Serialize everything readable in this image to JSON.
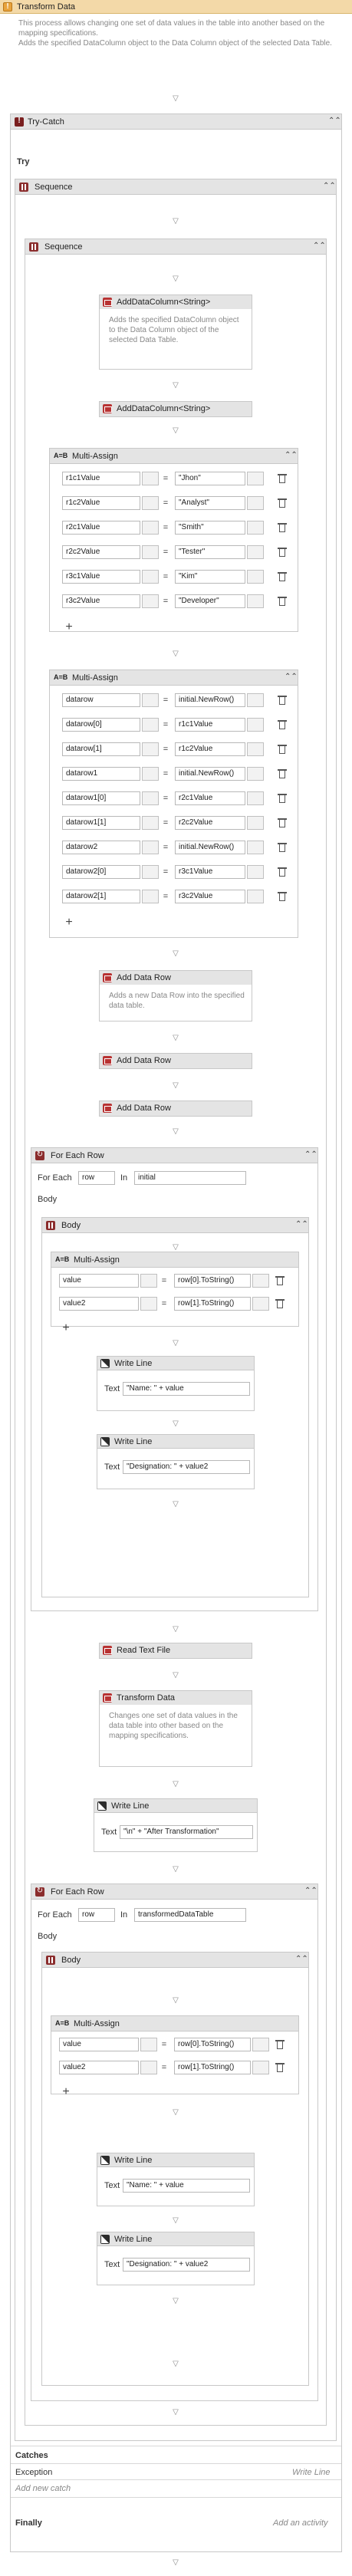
{
  "root": {
    "title": "Transform Data",
    "description": "This process allows changing one set of data values in the table into another based on the mapping specifications.\nAdds the specified DataColumn object to the Data Column object of the selected Data Table."
  },
  "try_catch": {
    "title": "Try-Catch",
    "try_label": "Try",
    "catches_label": "Catches",
    "exception_label": "Exception",
    "exception_action": "Write Line",
    "add_catch": "Add new catch",
    "finally_label": "Finally",
    "add_activity": "Add an activity"
  },
  "outer_sequence": {
    "title": "Sequence"
  },
  "inner_sequence": {
    "title": "Sequence",
    "add_col_1": {
      "title": "AddDataColumn<String>",
      "description": "Adds the specified DataColumn object to the Data Column object of the selected Data Table."
    },
    "add_col_2": {
      "title": "AddDataColumn<String>"
    },
    "multi_assign_1": {
      "title": "Multi-Assign",
      "rows": [
        {
          "left": "r1c1Value",
          "right": "\"Jhon\""
        },
        {
          "left": "r1c2Value",
          "right": "\"Analyst\""
        },
        {
          "left": "r2c1Value",
          "right": "\"Smith\""
        },
        {
          "left": "r2c2Value",
          "right": "\"Tester\""
        },
        {
          "left": "r3c1Value",
          "right": "\"Kim\""
        },
        {
          "left": "r3c2Value",
          "right": "\"Developer\""
        }
      ]
    },
    "multi_assign_2": {
      "title": "Multi-Assign",
      "rows": [
        {
          "left": "datarow",
          "right": "initial.NewRow()"
        },
        {
          "left": "datarow[0]",
          "right": "r1c1Value"
        },
        {
          "left": "datarow[1]",
          "right": "r1c2Value"
        },
        {
          "left": "datarow1",
          "right": "initial.NewRow()"
        },
        {
          "left": "datarow1[0]",
          "right": "r2c1Value"
        },
        {
          "left": "datarow1[1]",
          "right": "r2c2Value"
        },
        {
          "left": "datarow2",
          "right": "initial.NewRow()"
        },
        {
          "left": "datarow2[0]",
          "right": "r3c1Value"
        },
        {
          "left": "datarow2[1]",
          "right": "r3c2Value"
        }
      ]
    },
    "add_row_1": {
      "title": "Add Data Row",
      "description": "Adds a new Data Row into the specified data table."
    },
    "add_row_2": {
      "title": "Add Data Row"
    },
    "add_row_3": {
      "title": "Add Data Row"
    },
    "foreach_1": {
      "title": "For Each Row",
      "for_each_label": "For Each",
      "item": "row",
      "in_label": "In",
      "collection": "initial",
      "body_label": "Body",
      "body_seq_title": "Body",
      "multi_assign": {
        "title": "Multi-Assign",
        "rows": [
          {
            "left": "value",
            "right": "row[0].ToString()"
          },
          {
            "left": "value2",
            "right": "row[1].ToString()"
          }
        ]
      },
      "write_1": {
        "title": "Write Line",
        "text_label": "Text",
        "text": "\"Name: \" + value"
      },
      "write_2": {
        "title": "Write Line",
        "text_label": "Text",
        "text": "\"Designation: \" + value2"
      }
    },
    "read_text": {
      "title": "Read Text File"
    },
    "transform": {
      "title": "Transform Data",
      "description": "Changes one set of data values in the data table into other based on the mapping specifications."
    },
    "write_after": {
      "title": "Write Line",
      "text_label": "Text",
      "text": "\"\\n\" + \"After Transformation\""
    },
    "foreach_2": {
      "title": "For Each Row",
      "for_each_label": "For Each",
      "item": "row",
      "in_label": "In",
      "collection": "transformedDataTable",
      "body_label": "Body",
      "body_seq_title": "Body",
      "multi_assign": {
        "title": "Multi-Assign",
        "rows": [
          {
            "left": "value",
            "right": "row[0].ToString()"
          },
          {
            "left": "value2",
            "right": "row[1].ToString()"
          }
        ]
      },
      "write_1": {
        "title": "Write Line",
        "text_label": "Text",
        "text": "\"Name: \" + value"
      },
      "write_2": {
        "title": "Write Line",
        "text_label": "Text",
        "text": "\"Designation: \" + value2"
      }
    }
  },
  "icons": {
    "root": "try-catch-warning-icon",
    "try_catch": "try-catch-icon",
    "sequence": "sequence-icon",
    "activity": "activity-icon",
    "multi_assign": "multi-assign-icon",
    "write_line": "write-line-icon",
    "for_each": "for-each-icon",
    "collapse": "chevron-up-icon",
    "delete": "trash-icon",
    "add": "plus-icon",
    "drop": "drop-target-icon"
  },
  "colors": {
    "header_bg": "#e4e4e4",
    "border": "#c8c8c8",
    "sequence_icon": "#8b2d2d",
    "root_icon": "#e8a33d"
  }
}
